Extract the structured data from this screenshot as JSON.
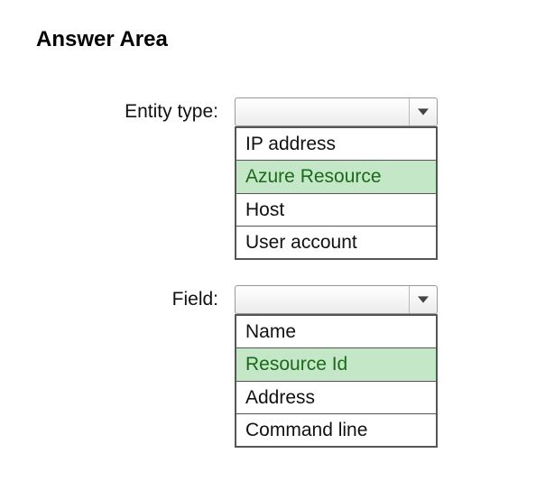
{
  "title": "Answer Area",
  "rows": [
    {
      "label": "Entity type:",
      "options": [
        "IP address",
        "Azure Resource",
        "Host",
        "User account"
      ],
      "selectedIndex": 1
    },
    {
      "label": "Field:",
      "options": [
        "Name",
        "Resource Id",
        "Address",
        "Command line"
      ],
      "selectedIndex": 1
    }
  ]
}
